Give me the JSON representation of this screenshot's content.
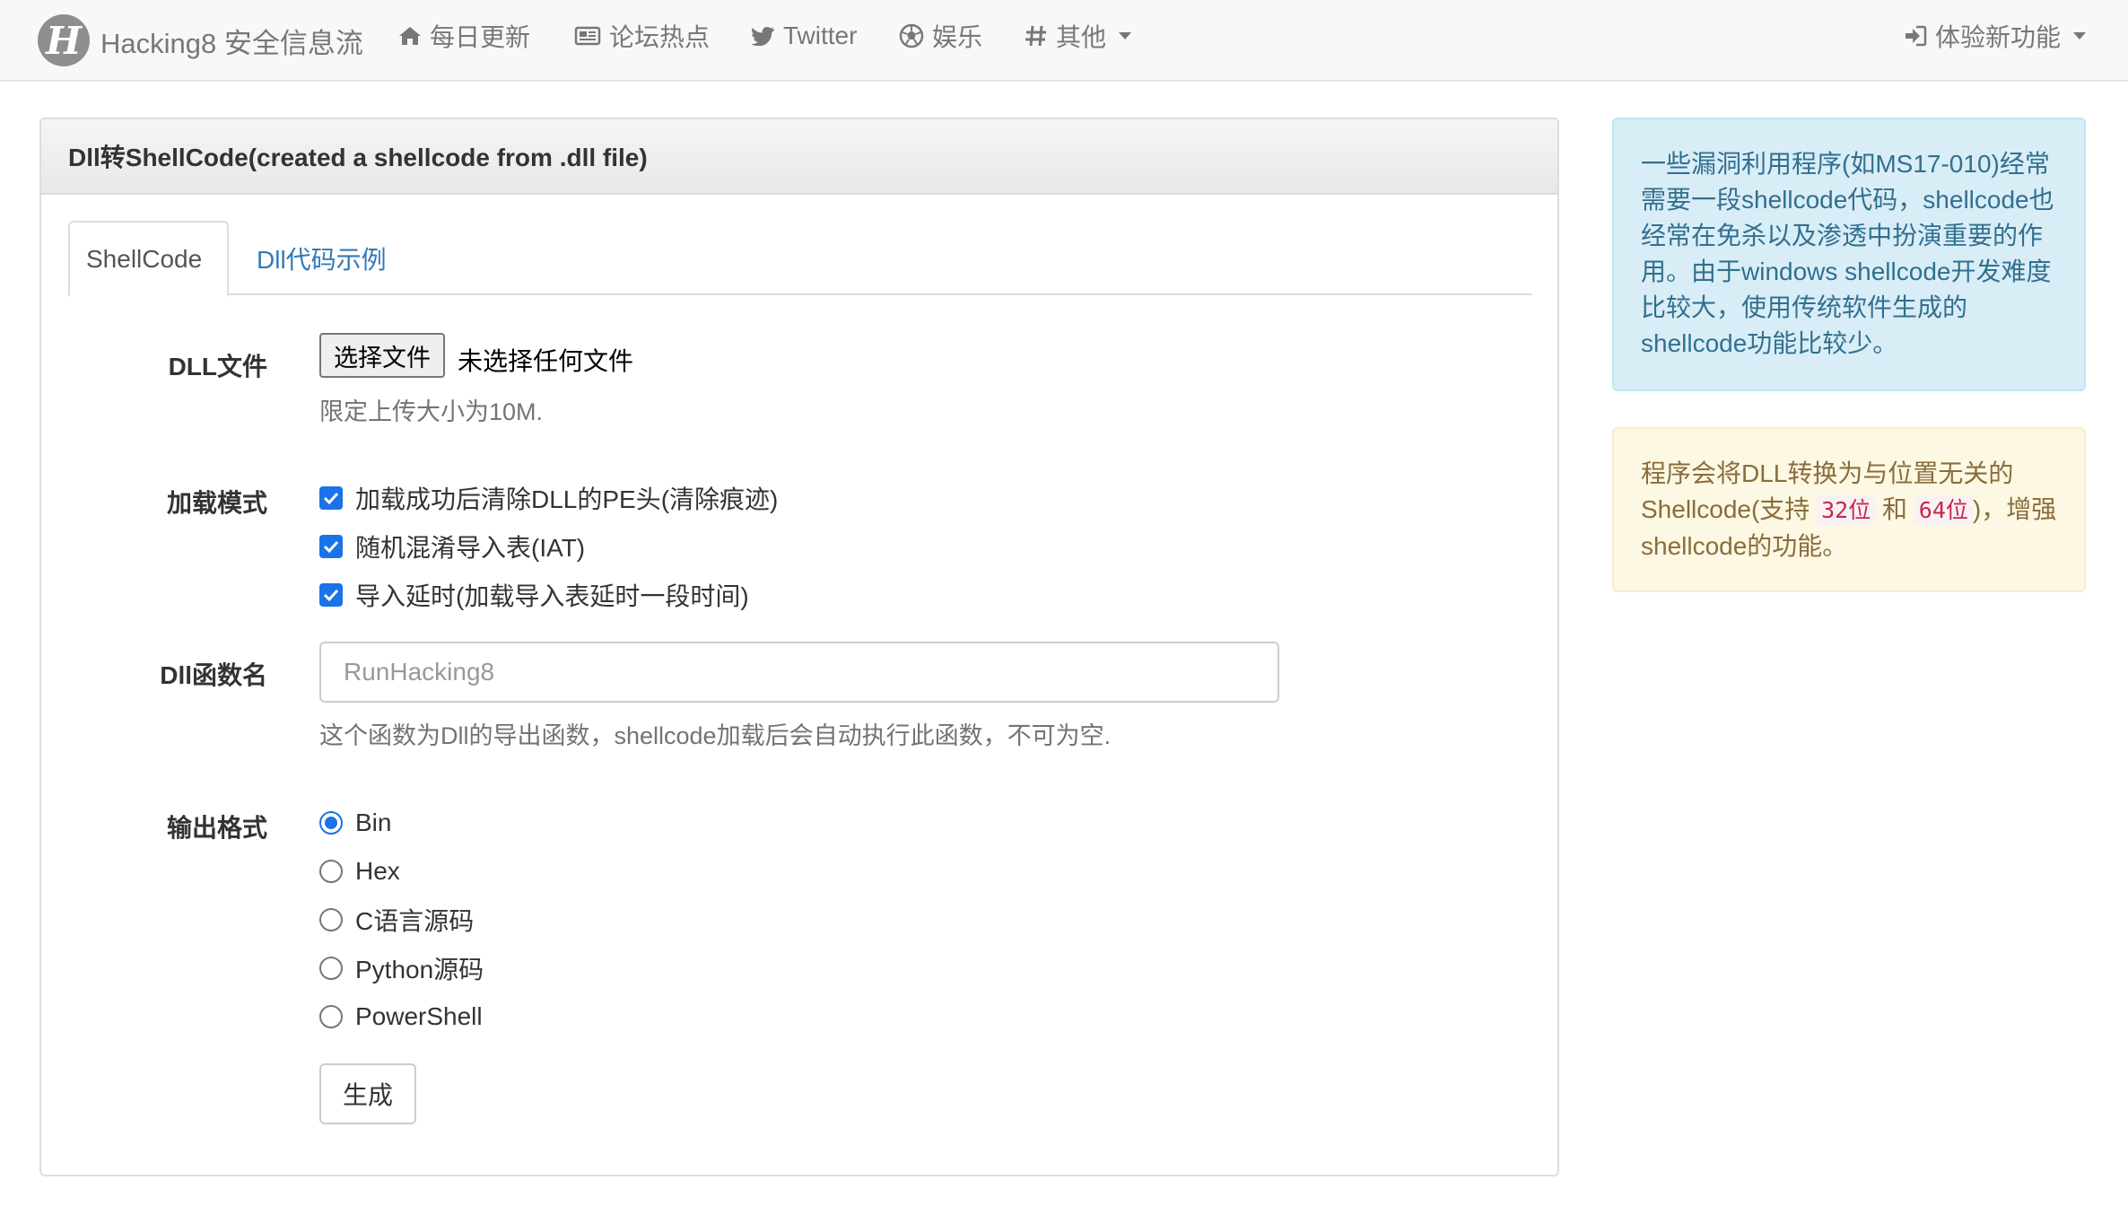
{
  "navbar": {
    "brand_logo_letter": "H",
    "brand": "Hacking8 安全信息流",
    "items": [
      {
        "label": "每日更新",
        "icon": "home-icon"
      },
      {
        "label": "论坛热点",
        "icon": "newspaper-icon"
      },
      {
        "label": "Twitter",
        "icon": "twitter-icon"
      },
      {
        "label": "娱乐",
        "icon": "soccer-ball-icon"
      },
      {
        "label": "其他",
        "icon": "hash-icon"
      }
    ],
    "right_item": {
      "label": "体验新功能",
      "icon": "sign-in-icon"
    }
  },
  "panel": {
    "title": "Dll转ShellCode(created a shellcode from .dll file)",
    "tabs": [
      {
        "label": "ShellCode",
        "active": true
      },
      {
        "label": "Dll代码示例",
        "active": false
      }
    ]
  },
  "form": {
    "dll_file": {
      "label": "DLL文件",
      "button_label": "选择文件",
      "no_file_text": "未选择任何文件",
      "help": "限定上传大小为10M."
    },
    "load_mode": {
      "label": "加载模式",
      "options": [
        {
          "label": "加载成功后清除DLL的PE头(清除痕迹)",
          "checked": true
        },
        {
          "label": "随机混淆导入表(IAT)",
          "checked": true
        },
        {
          "label": "导入延时(加载导入表延时一段时间)",
          "checked": true
        }
      ]
    },
    "function_name": {
      "label": "Dll函数名",
      "value": "",
      "placeholder": "RunHacking8",
      "help": "这个函数为Dll的导出函数，shellcode加载后会自动执行此函数，不可为空."
    },
    "output_format": {
      "label": "输出格式",
      "options": [
        {
          "label": "Bin",
          "checked": true
        },
        {
          "label": "Hex",
          "checked": false
        },
        {
          "label": "C语言源码",
          "checked": false
        },
        {
          "label": "Python源码",
          "checked": false
        },
        {
          "label": "PowerShell",
          "checked": false
        }
      ]
    },
    "submit_label": "生成"
  },
  "sidebar": {
    "info_text": "一些漏洞利用程序(如MS17-010)经常需要一段shellcode代码，shellcode也经常在免杀以及渗透中扮演重要的作用。由于windows shellcode开发难度比较大，使用传统软件生成的shellcode功能比较少。",
    "warning": {
      "prefix": "程序会将DLL转换为与位置无关的Shellcode(支持",
      "code1": "32位",
      "middle": "和",
      "code2": "64位",
      "suffix": ")，增强shellcode的功能。"
    }
  },
  "colors": {
    "navbar_bg": "#f8f8f8",
    "link": "#337ab7",
    "info_bg": "#d9edf7",
    "info_text": "#31708f",
    "warning_bg": "#fcf8e3",
    "warning_text": "#8a6d3b",
    "checkbox_accent": "#1a73e8"
  }
}
